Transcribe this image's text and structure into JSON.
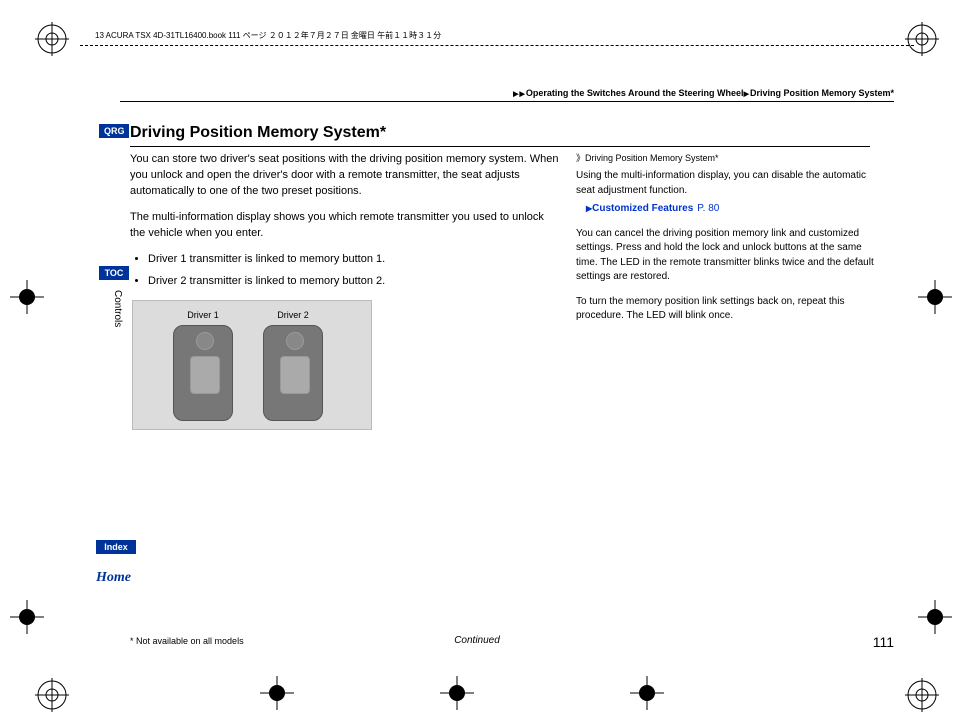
{
  "header": {
    "doc_line": "13 ACURA TSX 4D-31TL16400.book  111 ページ  ２０１２年７月２７日  金曜日  午前１１時３１分"
  },
  "breadcrumb": {
    "part1": "Operating the Switches Around the Steering Wheel",
    "part2": "Driving Position Memory System*"
  },
  "tabs": {
    "qrg": "QRG",
    "toc": "TOC",
    "index": "Index",
    "home": "Home"
  },
  "side_tab": "Controls",
  "title": "Driving Position Memory System*",
  "main": {
    "p1": "You can store two driver's seat positions with the driving position memory system. When you unlock and open the driver's door with a remote transmitter, the seat adjusts automatically to one of the two preset positions.",
    "p2": "The multi-information display shows you which remote transmitter you used to unlock the vehicle when you enter.",
    "li1": "Driver 1 transmitter is linked to memory button 1.",
    "li2": "Driver 2 transmitter is linked to memory button 2.",
    "img_label1": "Driver 1",
    "img_label2": "Driver 2"
  },
  "sidebar": {
    "head": "Driving Position Memory System*",
    "p1": "Using the multi-information display, you can disable the automatic seat adjustment function.",
    "link_label": "Customized Features",
    "link_page": "P. 80",
    "p2": "You can cancel the driving position memory link and customized settings. Press and hold the lock and unlock buttons at the same time. The LED in the remote transmitter blinks twice and the default settings are restored.",
    "p3": "To turn the memory position link settings back on, repeat this procedure. The LED will blink once."
  },
  "footer": {
    "note": "* Not available on all models",
    "continued": "Continued",
    "page": "111"
  }
}
